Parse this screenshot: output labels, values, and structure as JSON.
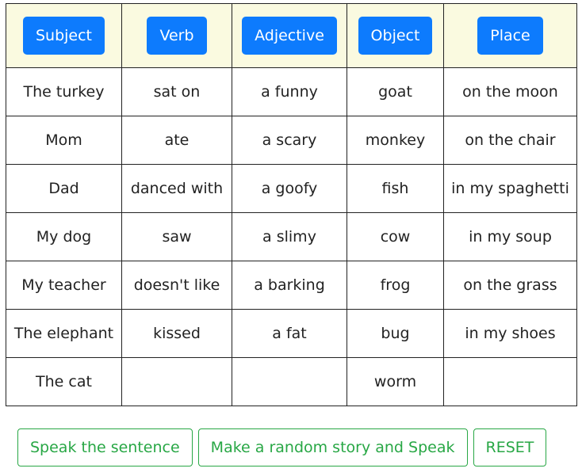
{
  "headers": [
    "Subject",
    "Verb",
    "Adjective",
    "Object",
    "Place"
  ],
  "rows": [
    [
      "The turkey",
      "sat on",
      "a funny",
      "goat",
      "on the moon"
    ],
    [
      "Mom",
      "ate",
      "a scary",
      "monkey",
      "on the chair"
    ],
    [
      "Dad",
      "danced with",
      "a goofy",
      "fish",
      "in my spaghetti"
    ],
    [
      "My dog",
      "saw",
      "a slimy",
      "cow",
      "in my soup"
    ],
    [
      "My teacher",
      "doesn't like",
      "a barking",
      "frog",
      "on the grass"
    ],
    [
      "The elephant",
      "kissed",
      "a fat",
      "bug",
      "in my shoes"
    ],
    [
      "The cat",
      "",
      "",
      "worm",
      ""
    ]
  ],
  "actions": {
    "speak_label": "Speak the sentence",
    "random_label": "Make a random story and Speak",
    "reset_label": "RESET"
  },
  "colors": {
    "header_button": "#0d7bfd",
    "header_background": "#fafae0",
    "action_button": "#28a745"
  }
}
